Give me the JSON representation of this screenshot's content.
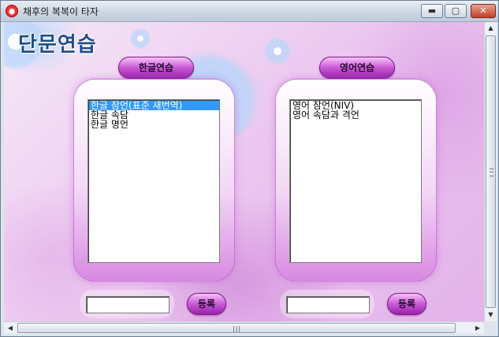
{
  "window": {
    "title": "채후의 복복이 타자",
    "minimize_glyph": "▬",
    "maximize_glyph": "▢",
    "close_glyph": "✕"
  },
  "app": {
    "logo_text": "단문연습"
  },
  "korean": {
    "tab_label": "한글연습",
    "items": [
      "한글 잠언(표준 새번역)",
      "한글 속담",
      "한글 명언"
    ],
    "selected_index": 0,
    "register_label": "등록",
    "input_value": ""
  },
  "english": {
    "tab_label": "영어연습",
    "items": [
      "영어 잠언(NIV)",
      "영어 속담과 격언"
    ],
    "register_label": "등록",
    "input_value": ""
  },
  "scroll": {
    "up": "▲",
    "down": "▼",
    "left": "◀",
    "right": "▶",
    "hgrip": "|||"
  },
  "icons": {
    "app": "app-face-icon"
  }
}
